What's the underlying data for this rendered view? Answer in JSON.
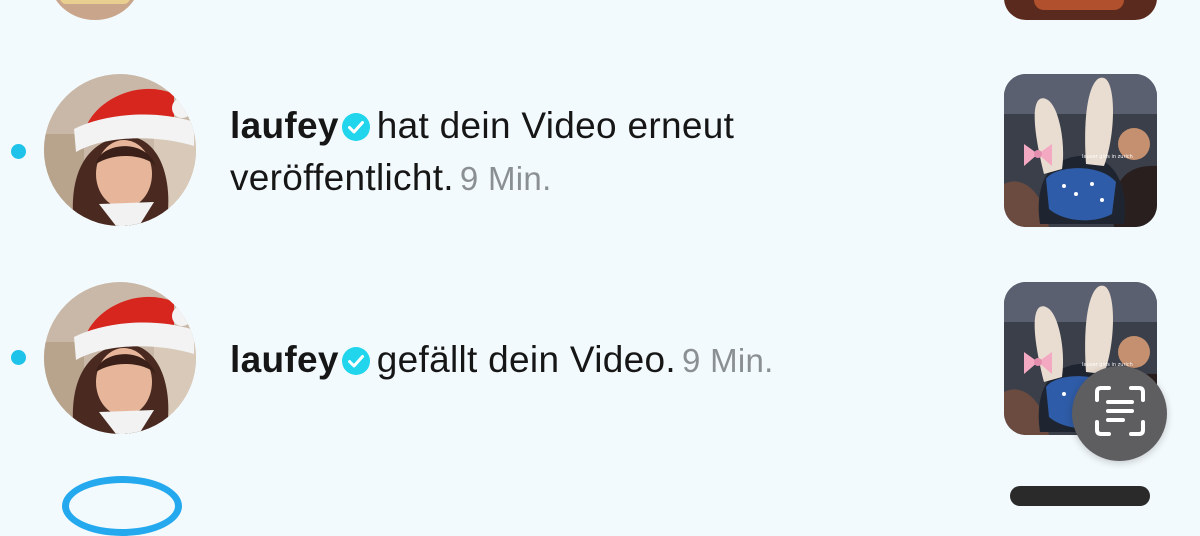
{
  "notifications": [
    {
      "username": "laufey",
      "verified": true,
      "line1": "hat dein Video erneut",
      "line2": "veröffentlicht.",
      "time": "9 Min.",
      "unread": true,
      "avatar_icon": "avatar-santa-hat",
      "thumbnail_caption": "lauver girls in zurich"
    },
    {
      "username": "laufey",
      "verified": true,
      "line1": "gefällt dein Video.",
      "time": "9 Min.",
      "unread": true,
      "avatar_icon": "avatar-santa-hat",
      "thumbnail_caption": "lauver girls in zurich"
    }
  ],
  "floating_button": {
    "icon": "text-scan-icon"
  },
  "colors": {
    "background": "#f3fafd",
    "unread_dot": "#1fc3ea",
    "verified_badge": "#20d5ec",
    "time_text": "#8a8f94",
    "fab": "#5e5e60"
  }
}
